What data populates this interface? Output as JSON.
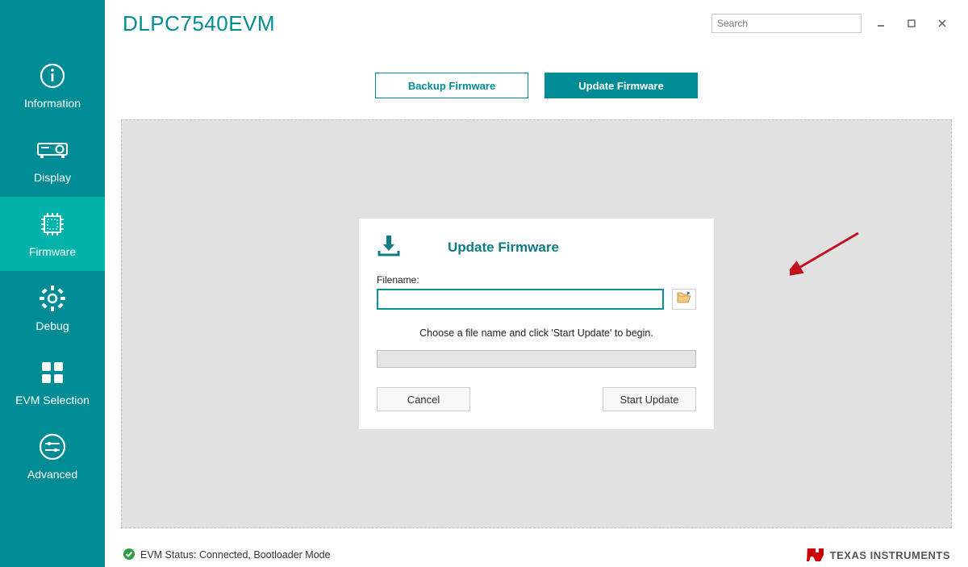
{
  "app_title": "DLPC7540EVM",
  "search": {
    "placeholder": "Search"
  },
  "sidebar": {
    "items": [
      {
        "label": "Information"
      },
      {
        "label": "Display"
      },
      {
        "label": "Firmware"
      },
      {
        "label": "Debug"
      },
      {
        "label": "EVM Selection"
      },
      {
        "label": "Advanced"
      }
    ]
  },
  "tabs": {
    "backup": "Backup Firmware",
    "update": "Update Firmware"
  },
  "card": {
    "title": "Update Firmware",
    "filename_label": "Filename:",
    "filename_value": "",
    "instruction": "Choose a file name and click 'Start Update' to begin.",
    "cancel": "Cancel",
    "start": "Start Update"
  },
  "status": {
    "text": "EVM Status: Connected, Bootloader Mode"
  },
  "footer": {
    "brand": "TEXAS INSTRUMENTS"
  }
}
